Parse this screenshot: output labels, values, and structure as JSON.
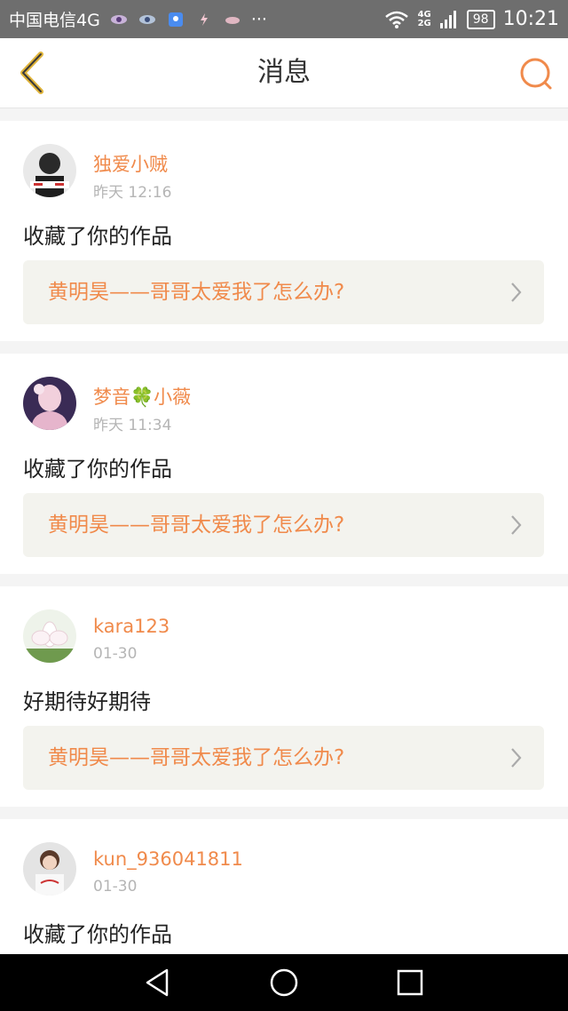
{
  "status_bar": {
    "carrier": "中国电信4G",
    "more": "···",
    "net_top": "4G",
    "net_bottom": "2G",
    "battery": "98",
    "time": "10:21"
  },
  "header": {
    "title": "消息",
    "accent": "#f08a4b"
  },
  "messages": [
    {
      "user": "独爱小贼",
      "time": "昨天 12:16",
      "action": "收藏了你的作品",
      "work": "黄明昊——哥哥太爱我了怎么办?"
    },
    {
      "user": "梦音🍀小薇",
      "time": "昨天 11:34",
      "action": "收藏了你的作品",
      "work": "黄明昊——哥哥太爱我了怎么办?"
    },
    {
      "user": "kara123",
      "time": "01-30",
      "action": "好期待好期待",
      "work": "黄明昊——哥哥太爱我了怎么办?"
    },
    {
      "user": "kun_936041811",
      "time": "01-30",
      "action": "收藏了你的作品",
      "work": ""
    }
  ],
  "icons": {
    "back": "back-chevron-icon",
    "search": "search-icon",
    "chevron": "chevron-right-icon",
    "nav_back": "triangle-back-icon",
    "nav_home": "circle-home-icon",
    "nav_recent": "square-recent-icon"
  }
}
